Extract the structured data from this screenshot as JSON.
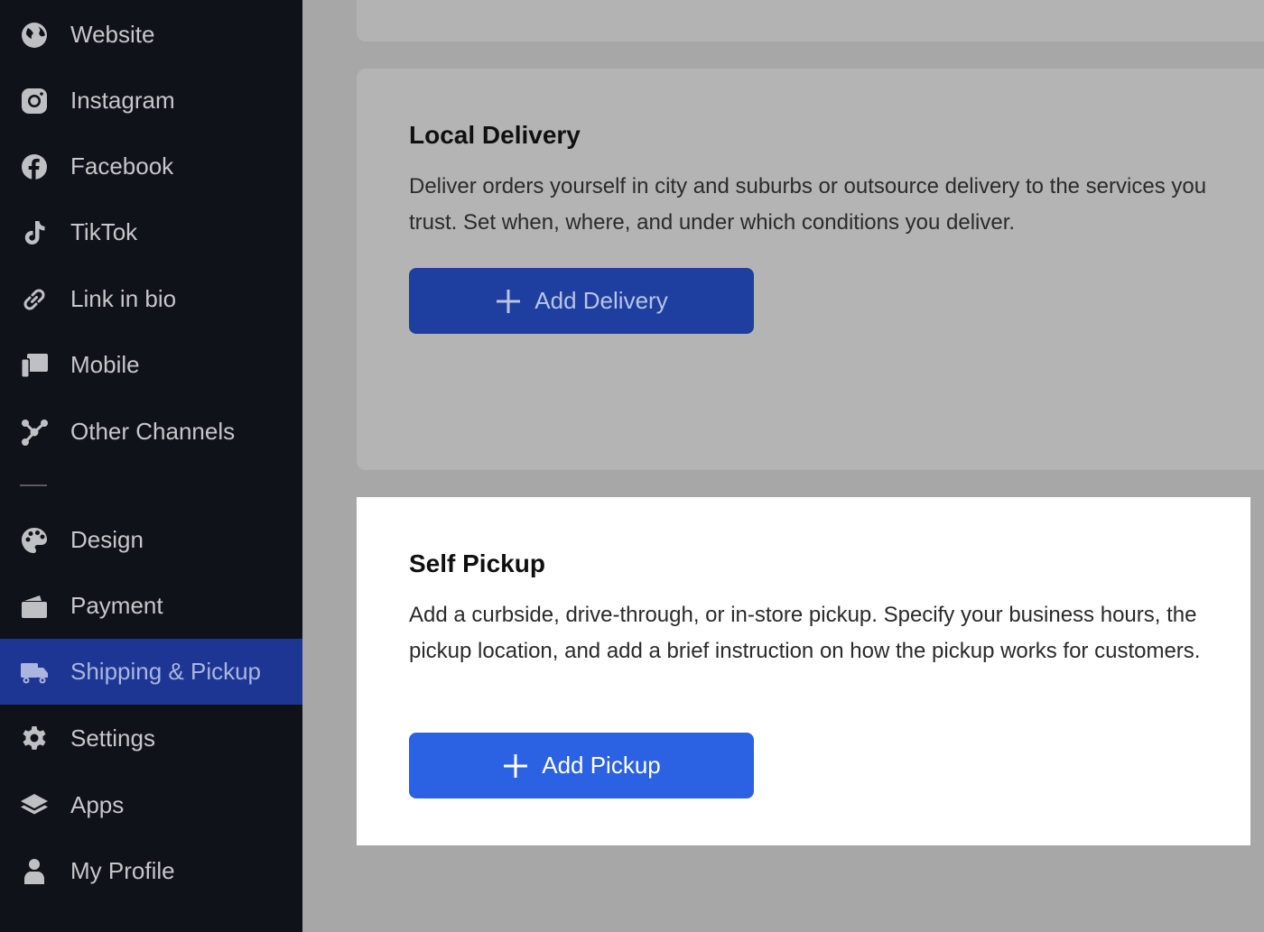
{
  "sidebar": {
    "items": [
      {
        "label": "Website",
        "icon": "globe-icon"
      },
      {
        "label": "Instagram",
        "icon": "instagram-icon"
      },
      {
        "label": "Facebook",
        "icon": "facebook-icon"
      },
      {
        "label": "TikTok",
        "icon": "tiktok-icon"
      },
      {
        "label": "Link in bio",
        "icon": "link-icon"
      },
      {
        "label": "Mobile",
        "icon": "mobile-icon"
      },
      {
        "label": "Other Channels",
        "icon": "share-nodes-icon"
      },
      {
        "label": "Design",
        "icon": "palette-icon"
      },
      {
        "label": "Payment",
        "icon": "wallet-icon"
      },
      {
        "label": "Shipping & Pickup",
        "icon": "truck-icon",
        "active": true
      },
      {
        "label": "Settings",
        "icon": "gear-icon"
      },
      {
        "label": "Apps",
        "icon": "layers-icon"
      },
      {
        "label": "My Profile",
        "icon": "user-icon"
      }
    ]
  },
  "main": {
    "local_delivery": {
      "title": "Local Delivery",
      "description": "Deliver orders yourself in city and suburbs or outsource delivery to the services you trust. Set when, where, and under which conditions you deliver.",
      "button_label": "Add Delivery"
    },
    "self_pickup": {
      "title": "Self Pickup",
      "description": "Add a curbside, drive-through, or in-store pickup. Specify your business hours, the pickup location, and add a brief instruction on how the pickup works for customers.",
      "button_label": "Add Pickup"
    }
  },
  "colors": {
    "sidebar_bg": "#10121a",
    "active_item_bg": "#1d3693",
    "primary_button": "#2b62e3",
    "dimmed_button": "#1e3fa0"
  }
}
